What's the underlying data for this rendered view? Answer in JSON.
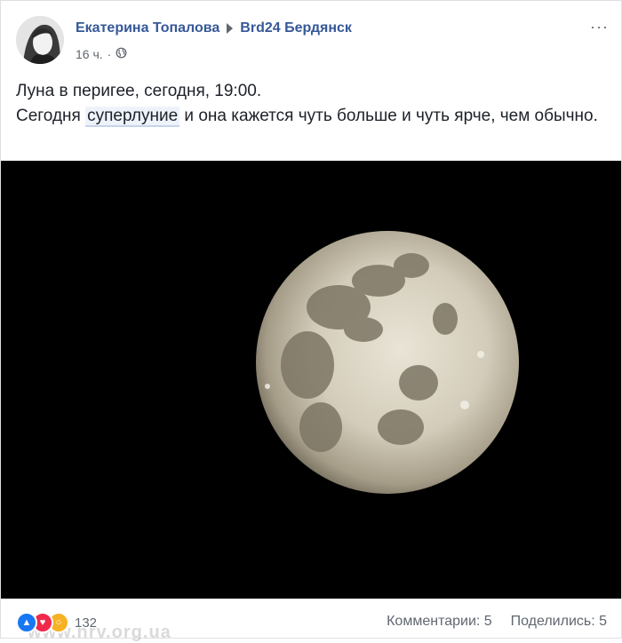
{
  "post": {
    "author": "Екатерина Топалова",
    "group": "Brd24 Бердянск",
    "time": "16 ч.",
    "dot": "·",
    "text_line1": "Луна в перигее, сегодня, 19:00.",
    "text_line2_before": "Сегодня ",
    "text_line2_highlight": "суперлуние",
    "text_line2_after": " и она кажется чуть больше и чуть ярче, чем обычно.",
    "more_label": "···"
  },
  "footer": {
    "reaction_count": "132",
    "comments_label": "Комментарии: 5",
    "shares_label": "Поделились: 5"
  },
  "watermark": "www.nrv.org.ua",
  "icons": {
    "privacy": "globe-icon",
    "reactions": [
      "like-icon",
      "love-icon",
      "wow-icon"
    ]
  },
  "colors": {
    "link": "#365899",
    "meta": "#606770",
    "like": "#1877f2",
    "love": "#f0284a",
    "wow": "#f7b125"
  }
}
